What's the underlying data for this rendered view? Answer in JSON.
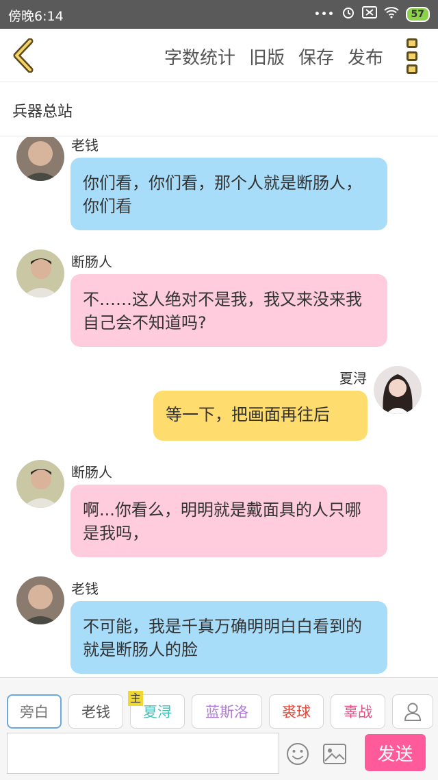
{
  "status_bar": {
    "time": "傍晚6:14",
    "battery": "57",
    "icons": [
      "dots-icon",
      "alarm-icon",
      "sim-off-icon",
      "wifi-icon",
      "battery-icon"
    ]
  },
  "toolbar": {
    "items": [
      "字数统计",
      "旧版",
      "保存",
      "发布"
    ]
  },
  "group": {
    "name": "兵器总站"
  },
  "messages": [
    {
      "sender": "老钱",
      "text": "你们看，你们看，那个人就是断肠人，你们看",
      "color": "#a8ddfa",
      "side": "left"
    },
    {
      "sender": "断肠人",
      "text": "不……这人绝对不是我，我又来没来我自己会不知道吗?",
      "color": "#ffccdd",
      "side": "left"
    },
    {
      "sender": "夏浔",
      "text": "等一下，把画面再往后",
      "color": "#ffdc6e",
      "side": "right"
    },
    {
      "sender": "断肠人",
      "text": "啊...你看么，明明就是戴面具的人只哪是我吗，",
      "color": "#ffccdd",
      "side": "left"
    },
    {
      "sender": "老钱",
      "text": "不可能，我是千真万确明明白白看到的就是断肠人的脸",
      "color": "#a8ddfa",
      "side": "left"
    }
  ],
  "characters": [
    {
      "name": "旁白",
      "color": "#777777"
    },
    {
      "name": "老钱",
      "color": "#555555"
    },
    {
      "name": "夏浔",
      "color": "#3fc3b8",
      "tag": "主"
    },
    {
      "name": "蓝斯洛",
      "color": "#b07ad6"
    },
    {
      "name": "裘球",
      "color": "#e14a3a"
    },
    {
      "name": "辜战",
      "color": "#e0507e"
    }
  ],
  "composer": {
    "input_value": "",
    "send_label": "发送"
  }
}
